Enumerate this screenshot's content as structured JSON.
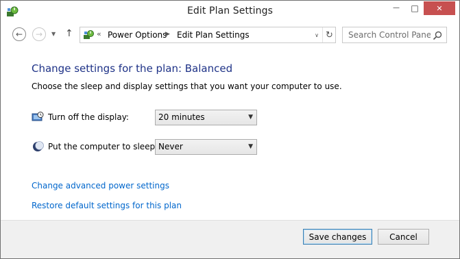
{
  "window": {
    "title": "Edit Plan Settings",
    "app_icon": "power-options-icon",
    "caption": {
      "minimize": "—",
      "maximize": "□",
      "close": "✕"
    }
  },
  "nav": {
    "back_glyph": "←",
    "forward_glyph": "→",
    "recent_glyph": "▼",
    "up_glyph": "↑",
    "address": {
      "prefix": "«",
      "crumbs": [
        "Power Options",
        "Edit Plan Settings"
      ],
      "crumb_separator": "▶",
      "dropdown_glyph": "∨",
      "refresh_glyph": "↻"
    },
    "search": {
      "placeholder": "Search Control Panel",
      "value": ""
    }
  },
  "main": {
    "heading": "Change settings for the plan: Balanced",
    "description": "Choose the sleep and display settings that you want your computer to use.",
    "settings": [
      {
        "icon": "display-timer-icon",
        "label": "Turn off the display:",
        "value": "20 minutes"
      },
      {
        "icon": "sleep-moon-icon",
        "label": "Put the computer to sleep:",
        "value": "Never"
      }
    ],
    "select_arrow": "▼",
    "links": [
      "Change advanced power settings",
      "Restore default settings for this plan"
    ]
  },
  "footer": {
    "save_label": "Save changes",
    "cancel_label": "Cancel"
  },
  "colors": {
    "heading": "#1e3287",
    "link": "#0066cc",
    "close_button": "#c75050",
    "footer_bg": "#f0f0f0"
  }
}
